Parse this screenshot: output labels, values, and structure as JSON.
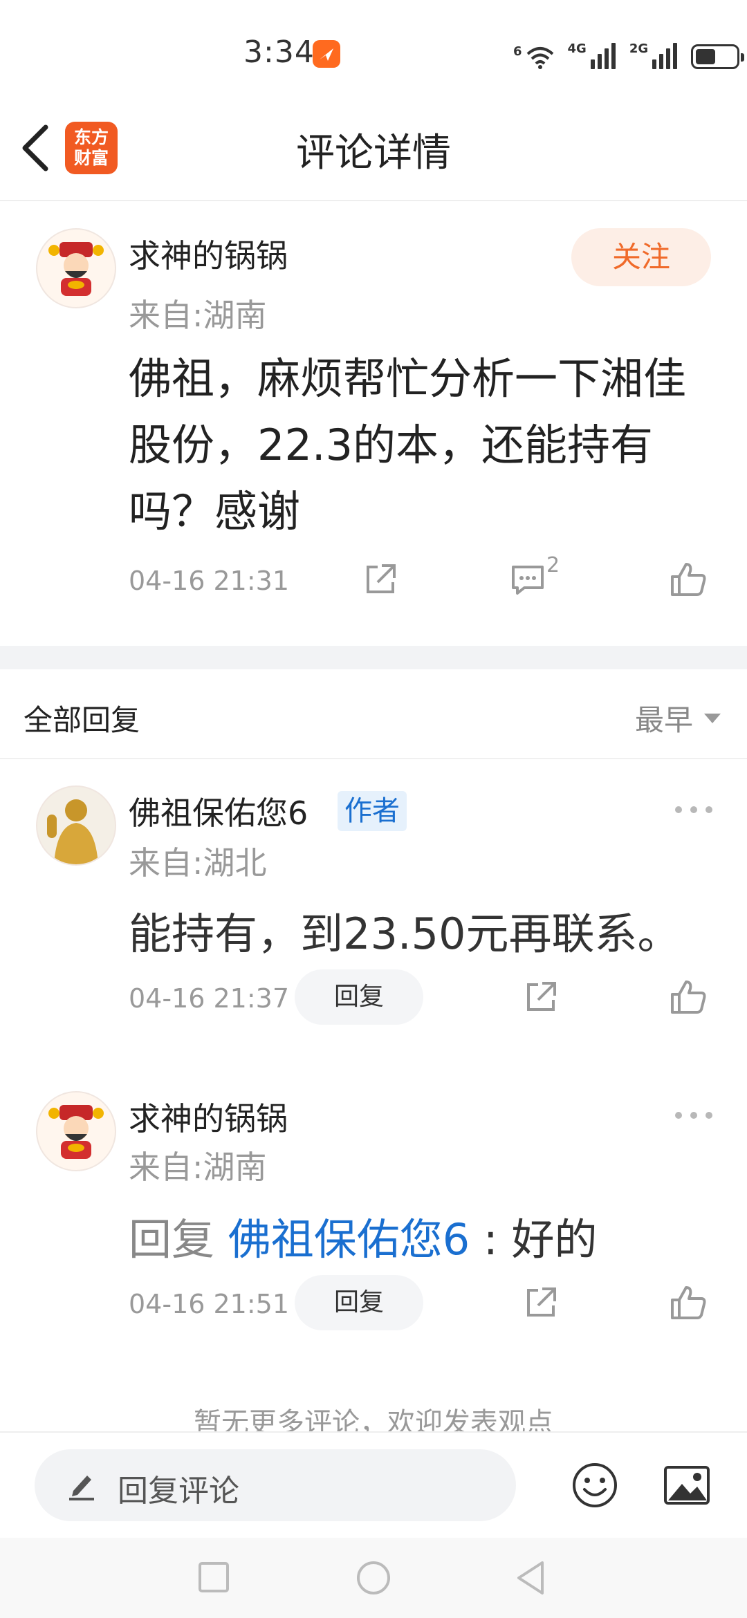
{
  "status_bar": {
    "time": "3:34",
    "net1": "6",
    "net2": "4G",
    "net3": "2G"
  },
  "header": {
    "title": "评论详情",
    "logo_line1": "东方",
    "logo_line2": "财富"
  },
  "main_comment": {
    "username": "求神的锅锅",
    "location": "来自:湖南",
    "follow_label": "关注",
    "content": "佛祖，麻烦帮忙分析一下湘佳股份，22.3的本，还能持有吗？感谢",
    "time": "04-16 21:31",
    "comment_count": "2"
  },
  "replies_section": {
    "title": "全部回复",
    "sort_label": "最早"
  },
  "replies": [
    {
      "username": "佛祖保佑您6",
      "badge": "作者",
      "location": "来自:湖北",
      "content": "能持有，到23.50元再联系。",
      "time": "04-16 21:37",
      "reply_label": "回复"
    },
    {
      "username": "求神的锅锅",
      "location": "来自:湖南",
      "prefix": "回复",
      "mention": "佛祖保佑您6",
      "separator": ":",
      "content": "好的",
      "time": "04-16 21:51",
      "reply_label": "回复"
    }
  ],
  "footer_note": "暂无更多评论，欢迎发表观点",
  "input_bar": {
    "placeholder": "回复评论"
  },
  "colors": {
    "accent": "#f06a2a",
    "link": "#1a6fd0",
    "brand": "#f15a22"
  }
}
